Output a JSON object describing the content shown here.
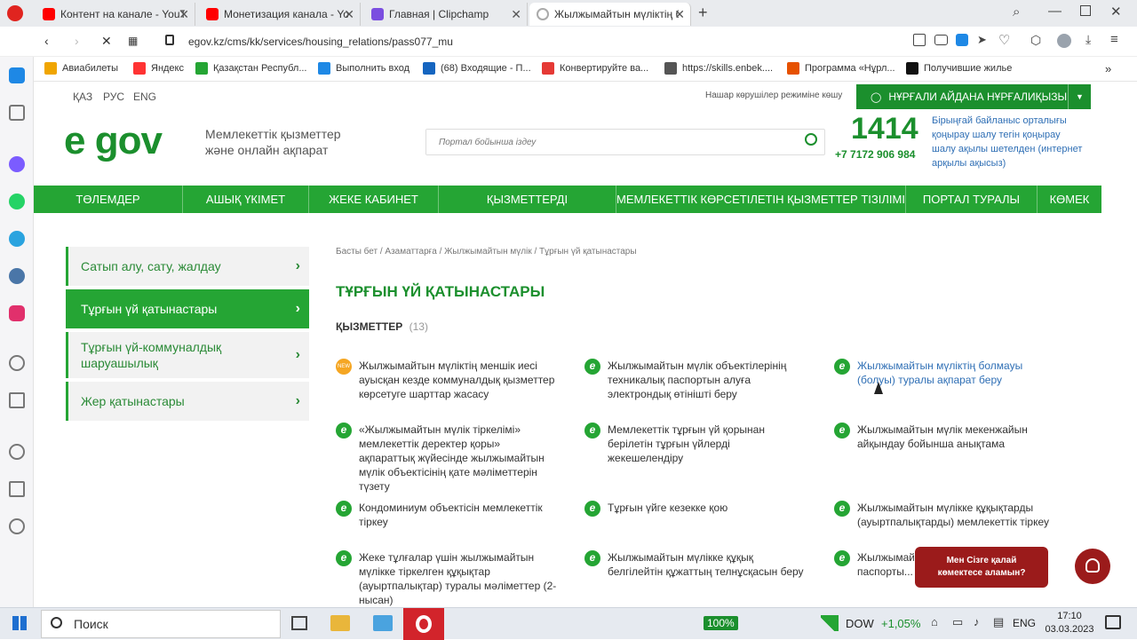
{
  "browser": {
    "tabs": [
      {
        "title": "Контент на канале - YouTube",
        "color": "#ff0000"
      },
      {
        "title": "Монетизация канала - YouTube",
        "color": "#ff0000"
      },
      {
        "title": "Главная | Clipchamp",
        "color": "#7b4ee0"
      },
      {
        "title": "Жылжымайтын мүліктің б",
        "color": "#bbbbbb"
      }
    ],
    "url": "egov.kz/cms/kk/services/housing_relations/pass077_mu",
    "bookmarks": [
      {
        "label": "Авиабилеты",
        "color": "#f0a500"
      },
      {
        "label": "Яндекс",
        "color": "#ff3333"
      },
      {
        "label": "Қазақстан Республ...",
        "color": "#25a534"
      },
      {
        "label": "Выполнить вход",
        "color": "#1e88e5"
      },
      {
        "label": "(68) Входящие - П...",
        "color": "#1565c0"
      },
      {
        "label": "Конвертируйте ва...",
        "color": "#e53935"
      },
      {
        "label": "https://skills.enbek....",
        "color": "#555555"
      },
      {
        "label": "Программа «Нұрл...",
        "color": "#e65100"
      },
      {
        "label": "Получившие жилье",
        "color": "#111111"
      }
    ]
  },
  "site": {
    "langs": [
      "ҚАЗ",
      "РУС",
      "ENG"
    ],
    "accessibility": "Нашар көрушілер режиміне көшу",
    "user_name": "НҰРҒАЛИ АЙДАНА НҰРҒАЛИҚЫЗЫ",
    "logo_text": "e gov",
    "tagline_line1": "Мемлекеттік қызметтер",
    "tagline_line2": "және онлайн ақпарат",
    "search_placeholder": "Портал бойынша іздеу",
    "call_number": "1414",
    "call_phone": "+7 7172 906 984",
    "call_desc": "Бірыңғай байланыс орталығы қоңырау шалу тегін қоңырау шалу ақылы шетелден (интернет арқылы ақысыз)",
    "nav": [
      "ТӨЛЕМДЕР",
      "АШЫҚ ҮКІМЕТ",
      "ЖЕКЕ КАБИНЕТ",
      "ҚЫЗМЕТТЕРДІ АПРОБАЦИЯЛАУ",
      "МЕМЛЕКЕТТІК КӨРСЕТІЛЕТІН ҚЫЗМЕТТЕР ТІЗІЛІМІ",
      "ПОРТАЛ ТУРАЛЫ",
      "КӨМЕК"
    ]
  },
  "left_menu": [
    {
      "label": "Сатып алу, сату, жалдау",
      "active": false
    },
    {
      "label": "Тұрғын үй қатынастары",
      "active": true
    },
    {
      "label": "Тұрғын үй-коммуналдық шаруашылық",
      "active": false
    },
    {
      "label": "Жер қатынастары",
      "active": false
    }
  ],
  "content": {
    "breadcrumb": "Басты бет / Азаматтарға / Жылжымайтын мүлік / Тұрғын үй қатынастары",
    "title": "ТҰРҒЫН ҮЙ ҚАТЫНАСТАРЫ",
    "services_label": "ҚЫЗМЕТТЕР",
    "services_count": "(13)",
    "services": [
      {
        "text": "Жылжымайтын мүліктің меншік иесі ауысқан кезде коммуналдық қызметтер көрсетуге шарттар жасасу",
        "icon": "new"
      },
      {
        "text": "Жылжымайтын мүлік объектілерінің техникалық паспортын алуға электрондық өтінішті беру",
        "icon": "e"
      },
      {
        "text": "Жылжымайтын мүліктің болмауы (болуы) туралы ақпарат беру",
        "icon": "e",
        "link": true
      },
      {
        "text": "«Жылжымайтын мүлік тіркелімі» мемлекеттік деректер қоры» ақпараттық жүйесінде жылжымайтын мүлік объектісінің қате мәліметтерін түзету",
        "icon": "e"
      },
      {
        "text": "Мемлекеттік тұрғын үй қорынан берілетін тұрғын үйлерді жекешелендіру",
        "icon": "e"
      },
      {
        "text": "Жылжымайтын мүлік мекенжайын айқындау бойынша анықтама",
        "icon": "e"
      },
      {
        "text": "Кондоминиум объектісін мемлекеттік тіркеу",
        "icon": "e"
      },
      {
        "text": "Тұрғын үйге кезекке қою",
        "icon": "e"
      },
      {
        "text": "Жылжымайтын мүлікке құқықтарды (ауыртпалықтарды) мемлекеттік тіркеу",
        "icon": "e"
      },
      {
        "text": "Жеке тұлғалар үшін жылжымайтын мүлікке тіркелген құқықтар (ауыртпалықтар) туралы мәліметтер (2-нысан)",
        "icon": "e"
      },
      {
        "text": "Жылжымайтын мүлікке құқық белгілейтін құжаттың телнұсқасын беру",
        "icon": "e"
      },
      {
        "text": "Жылжымай... паспорты...",
        "icon": "e"
      }
    ],
    "chat_bubble": "Мен Сізге қалай көмектесе аламын?"
  },
  "taskbar": {
    "search": "Поиск",
    "zoom": "100%",
    "stock": "DOW",
    "stock_change": "+1,05%",
    "lang": "ENG",
    "time": "17:10",
    "date": "03.03.2023"
  },
  "colors": {
    "brand_green": "#25a534",
    "dark_green": "#1b8f2d",
    "chat_red": "#9b1b1b"
  }
}
